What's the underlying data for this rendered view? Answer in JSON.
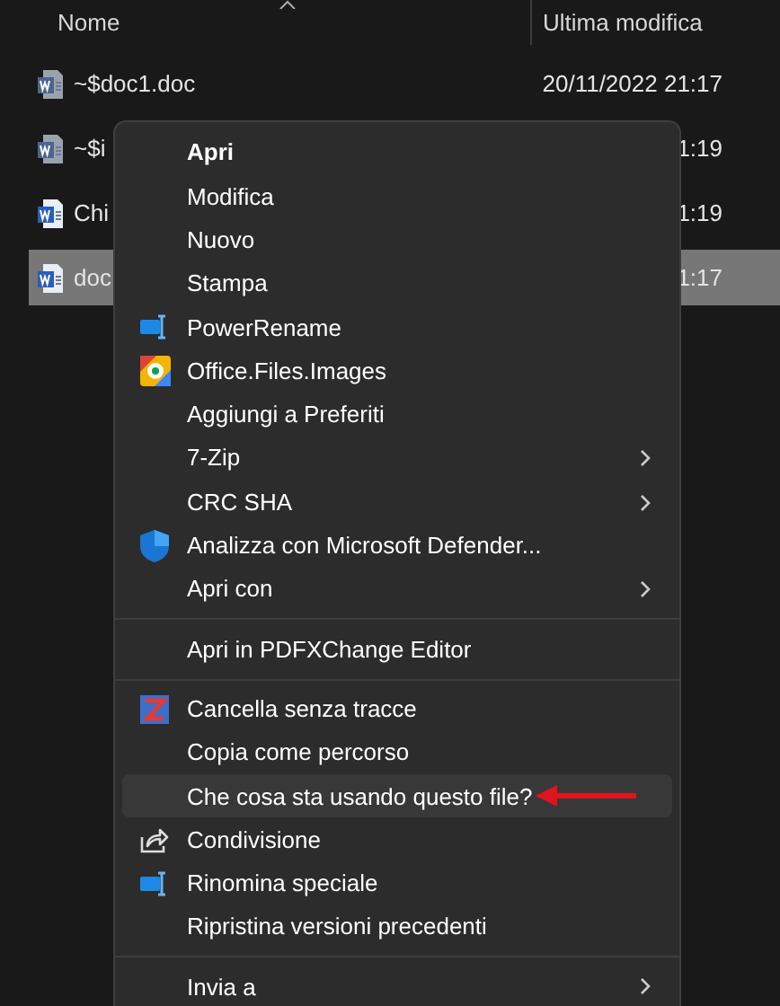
{
  "columns": [
    {
      "label": "Nome"
    },
    {
      "label": "Ultima modifica"
    }
  ],
  "files": [
    {
      "name": "~$doc1.doc",
      "modified": "20/11/2022 21:17",
      "selected": false,
      "kind": "temp"
    },
    {
      "name": "~$i",
      "modified": "1:19",
      "selected": false,
      "kind": "temp"
    },
    {
      "name": "Chi",
      "modified": "1:19",
      "selected": false,
      "kind": "word"
    },
    {
      "name": "doc",
      "modified": "1:17",
      "selected": true,
      "kind": "word"
    }
  ],
  "context_menu": [
    {
      "kind": "plain",
      "label": "Apri",
      "bold": true,
      "submenu": false,
      "selected": false
    },
    {
      "kind": "plain",
      "label": "Modifica",
      "bold": false,
      "submenu": false,
      "selected": false
    },
    {
      "kind": "plain",
      "label": "Nuovo",
      "bold": false,
      "submenu": false,
      "selected": false
    },
    {
      "kind": "plain",
      "label": "Stampa",
      "bold": false,
      "submenu": false,
      "selected": false
    },
    {
      "kind": "rename",
      "label": "PowerRename",
      "bold": false,
      "submenu": false,
      "selected": false
    },
    {
      "kind": "images",
      "label": "Office.Files.Images",
      "bold": false,
      "submenu": false,
      "selected": false
    },
    {
      "kind": "plain",
      "label": "Aggiungi a Preferiti",
      "bold": false,
      "submenu": false,
      "selected": false
    },
    {
      "kind": "plain",
      "label": "7-Zip",
      "bold": false,
      "submenu": true,
      "selected": false
    },
    {
      "kind": "plain",
      "label": "CRC SHA",
      "bold": false,
      "submenu": true,
      "selected": false
    },
    {
      "kind": "shield",
      "label": "Analizza con Microsoft Defender...",
      "bold": false,
      "submenu": false,
      "selected": false
    },
    {
      "kind": "plain",
      "label": "Apri con",
      "bold": false,
      "submenu": true,
      "selected": false
    },
    {
      "kind": "separator"
    },
    {
      "kind": "plain",
      "label": "Apri in PDFXChange Editor",
      "bold": false,
      "submenu": false,
      "selected": false
    },
    {
      "kind": "separator"
    },
    {
      "kind": "eraser",
      "label": "Cancella senza tracce",
      "bold": false,
      "submenu": false,
      "selected": false
    },
    {
      "kind": "plain",
      "label": "Copia come percorso",
      "bold": false,
      "submenu": false,
      "selected": false
    },
    {
      "kind": "plain",
      "label": "Che cosa sta usando questo file?",
      "bold": false,
      "submenu": false,
      "selected": true,
      "arrow": true
    },
    {
      "kind": "share",
      "label": "Condivisione",
      "bold": false,
      "submenu": false,
      "selected": false
    },
    {
      "kind": "rename",
      "label": "Rinomina speciale",
      "bold": false,
      "submenu": false,
      "selected": false
    },
    {
      "kind": "plain",
      "label": "Ripristina versioni precedenti",
      "bold": false,
      "submenu": false,
      "selected": false
    },
    {
      "kind": "separator"
    },
    {
      "kind": "plain",
      "label": "Invia a",
      "bold": false,
      "submenu": true,
      "selected": false
    }
  ]
}
